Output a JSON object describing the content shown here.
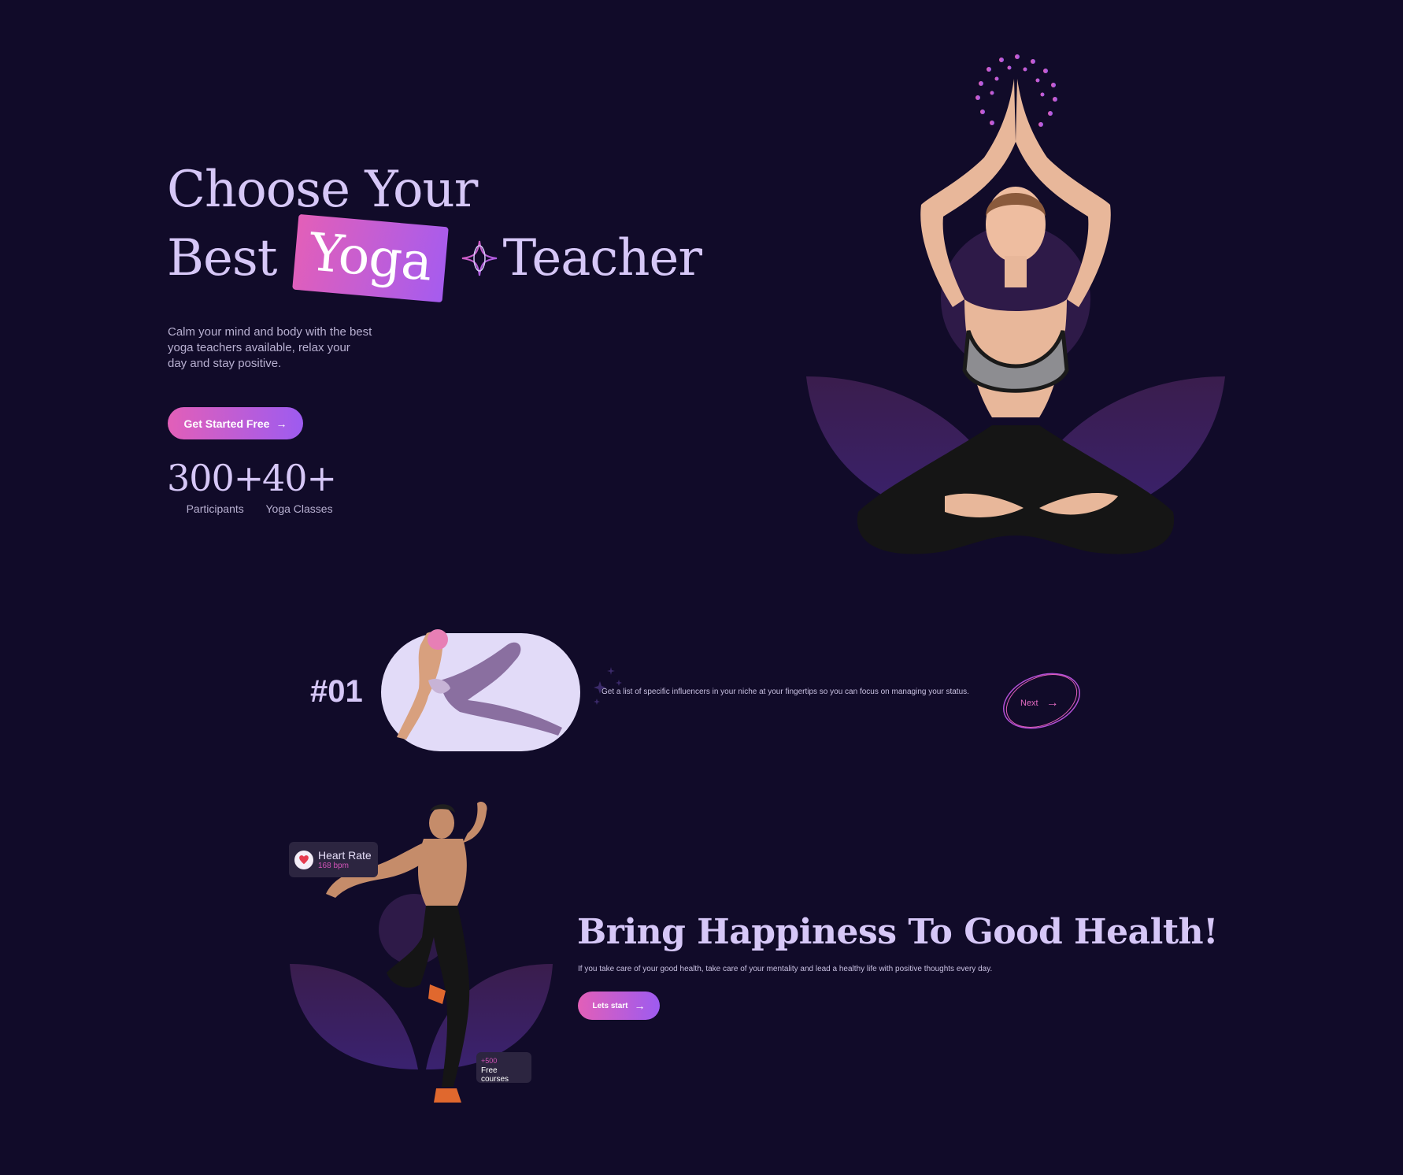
{
  "hero": {
    "title_line1": "Choose Your",
    "title_best": "Best",
    "title_yoga": "Yoga",
    "title_teacher": "Teacher",
    "description": "Calm your mind and body with the best yoga teachers available, relax your day and stay positive.",
    "cta_label": "Get Started Free",
    "stats": [
      {
        "value": "300+",
        "label": "Participants"
      },
      {
        "value": "40+",
        "label": "Yoga Classes"
      }
    ]
  },
  "feature_row": {
    "number": "#01",
    "description": "Get a list of specific influencers in your niche at your fingertips so you can focus on managing your status.",
    "next_label": "Next"
  },
  "health_section": {
    "heart_rate_title": "Heart Rate",
    "heart_rate_value": "168 bpm",
    "courses_count": "+500",
    "courses_label": "Free courses",
    "title": "Bring Happiness To Good Health!",
    "description": "If you take care of your good health, take care of your mentality and lead a healthy life with positive thoughts every day.",
    "cta_label": "Lets start"
  },
  "colors": {
    "background": "#110b29",
    "accent_pink": "#e25fb8",
    "accent_purple": "#9d5bf0",
    "heading": "#d6c7f7"
  }
}
